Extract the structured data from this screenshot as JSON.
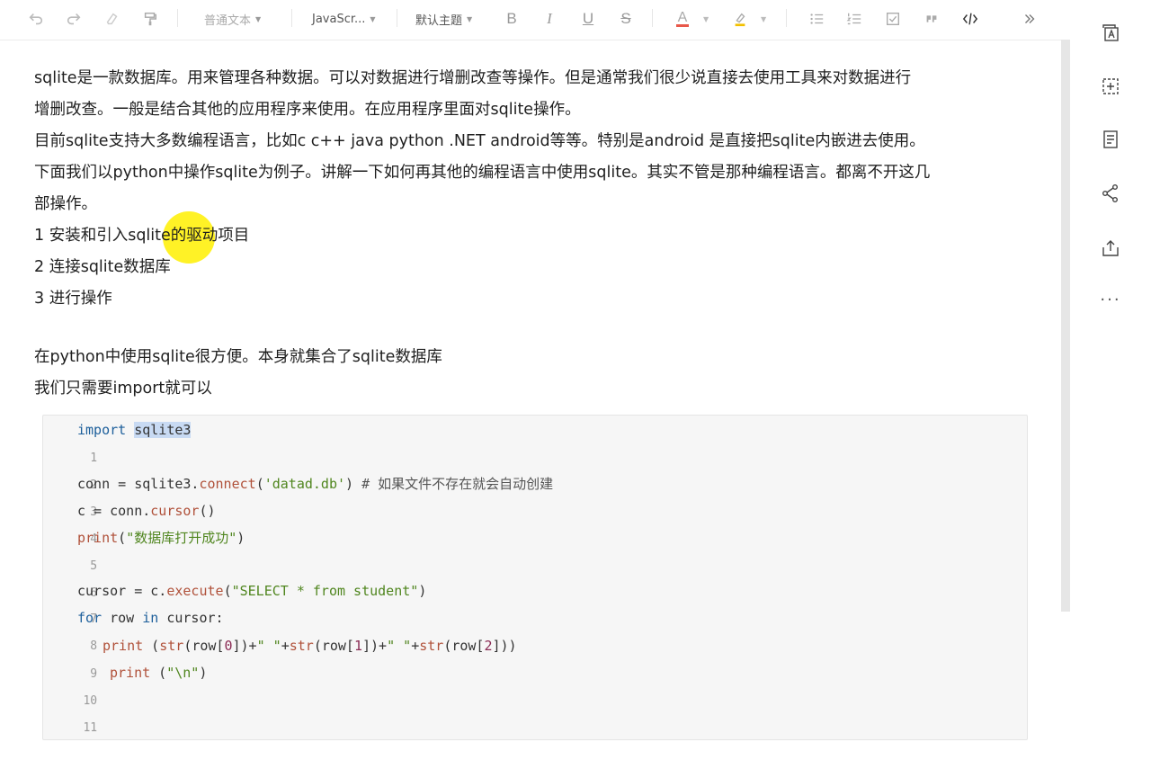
{
  "toolbar": {
    "paragraph_style": "普通文本",
    "code_language": "JavaScr...",
    "theme": "默认主题",
    "bold": "B",
    "italic": "I",
    "underline": "U",
    "strikethrough": "S",
    "font_color": "A"
  },
  "document": {
    "paragraphs": [
      "sqlite是一款数据库。用来管理各种数据。可以对数据进行增删改查等操作。但是通常我们很少说直接去使用工具来对数据进行",
      "增删改查。一般是结合其他的应用程序来使用。在应用程序里面对sqlite操作。",
      "目前sqlite支持大多数编程语言，比如c c++ java python .NET android等等。特别是android 是直接把sqlite内嵌进去使用。",
      "下面我们以python中操作sqlite为例子。讲解一下如何再其他的编程语言中使用sqlite。其实不管是那种编程语言。都离不开这几",
      "部操作。",
      "1 安装和引入sqlite的驱动项目",
      "2 连接sqlite数据库",
      "3 进行操作"
    ],
    "paragraphs2": [
      "在python中使用sqlite很方便。本身就集合了sqlite数据库",
      "我们只需要import就可以"
    ]
  },
  "code_block": {
    "line_numbers": [
      "1",
      "2",
      "3",
      "4",
      "5",
      "6",
      "7",
      "8",
      "9",
      "10",
      "11"
    ],
    "l1": {
      "kw": "import",
      "sp": " ",
      "sel": "sqlite3"
    },
    "l3": {
      "a": "conn = sqlite3.",
      "fn": "connect",
      "b": "(",
      "str": "'datad.db'",
      "c": ") ",
      "cm": "# 如果文件不存在就会自动创建"
    },
    "l4": {
      "a": "c = conn.",
      "fn": "cursor",
      "b": "()"
    },
    "l5": {
      "fn": "print",
      "b": "(",
      "str": "\"数据库打开成功\"",
      "c": ")"
    },
    "l7": {
      "a": "cursor = c.",
      "fn": "execute",
      "b": "(",
      "str": "\"SELECT * from student\"",
      "c": ")"
    },
    "l8": {
      "kw1": "for",
      "a": " row ",
      "kw2": "in",
      "b": " cursor:"
    },
    "l9": {
      "fn": "print",
      "a": " (",
      "fn2": "str",
      "b": "(row[",
      "n0": "0",
      "c": "])+",
      "s1": "\" \"",
      "d": "+",
      "fn3": "str",
      "e": "(row[",
      "n1": "1",
      "f": "])+",
      "s2": "\" \"",
      "g": "+",
      "fn4": "str",
      "h": "(row[",
      "n2": "2",
      "i": "]))"
    },
    "l10": {
      "fn": "print",
      "a": " (",
      "str": "\"\\n\"",
      "b": ")"
    }
  }
}
